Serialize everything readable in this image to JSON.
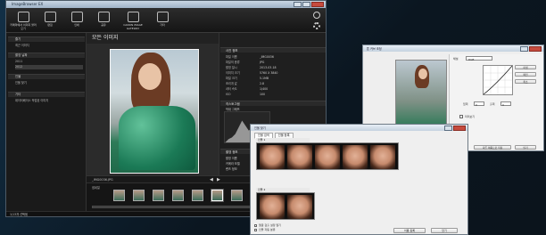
{
  "app": {
    "title": "ImageBrowser EX",
    "toolbar": [
      {
        "label": "카메라에서\n이미지 불러오기",
        "icon": "camera-icon"
      },
      {
        "label": "편집",
        "icon": "edit-icon"
      },
      {
        "label": "인쇄",
        "icon": "print-icon"
      },
      {
        "label": "공유",
        "icon": "share-icon"
      },
      {
        "label": "CANON iMAGE\nGATEWAY",
        "icon": "gateway-icon"
      },
      {
        "label": "기타",
        "icon": "more-icon"
      }
    ],
    "help_icon": "help-icon",
    "settings_icon": "gear-icon",
    "sidebar": {
      "sections": [
        {
          "title": "즐기",
          "items": [
            "최근 이미지"
          ]
        },
        {
          "title": "촬영 날짜",
          "items": [
            "2011",
            "2012"
          ]
        },
        {
          "title": "인물",
          "items": [
            "인물 찾기"
          ]
        },
        {
          "title": "기타",
          "items": [
            "데이터베이스 작업된 이미지"
          ]
        }
      ]
    },
    "content_title": "모든 이미지",
    "filename": "_IMG0036.JPG",
    "thumbs_label": "썸네일",
    "status": "1/13개 선택됨",
    "info_panel": {
      "title": "사진 정보",
      "rows": [
        {
          "k": "파일 이름",
          "v": "_IMG0036"
        },
        {
          "k": "파일의 종류",
          "v": "JPG"
        },
        {
          "k": "촬영 일시",
          "v": "2013-03-18"
        },
        {
          "k": "이미지 크기",
          "v": "5760 X 3840"
        },
        {
          "k": "파일 크기",
          "v": "5.1MB"
        },
        {
          "k": "조리개 값",
          "v": "2.8"
        },
        {
          "k": "셔터 속도",
          "v": "1/400"
        },
        {
          "k": "ISO",
          "v": "100"
        }
      ],
      "histogram_title": "히스토그램",
      "histogram_label": "막대 그래프",
      "exif_title": "촬영 정보",
      "exif_rows": [
        "촬영 이름",
        "카메라 모델",
        "렌즈 정보"
      ]
    }
  },
  "curves_dialog": {
    "title": "톤 커브 조정",
    "channel_label": "채널",
    "channel_value": "RGB",
    "input_label": "입력",
    "output_label": "출력",
    "input_value": "0",
    "output_value": "0",
    "buttons": [
      "리셋",
      "확인",
      "취소"
    ],
    "checkbox_preview": "미리보기",
    "footer_button": "다른 이름으로 저장",
    "close_button": "닫기"
  },
  "face_dialog": {
    "title": "인물 찾기",
    "tabs": [
      "인물 검색",
      "인물 등록"
    ],
    "group1_label": "인물 1",
    "group2_label": "인물 2",
    "group1_faces": 5,
    "group2_faces": 2,
    "buttons": [
      "이름 등록",
      "닫기"
    ],
    "footer_check1": "얼굴 검출 설정 열기",
    "footer_check2": "인물 자동 분류"
  },
  "colors": {
    "desktop": "#0b1620",
    "window_bg": "#1d1d1d",
    "accent": "#3b8ccf"
  }
}
